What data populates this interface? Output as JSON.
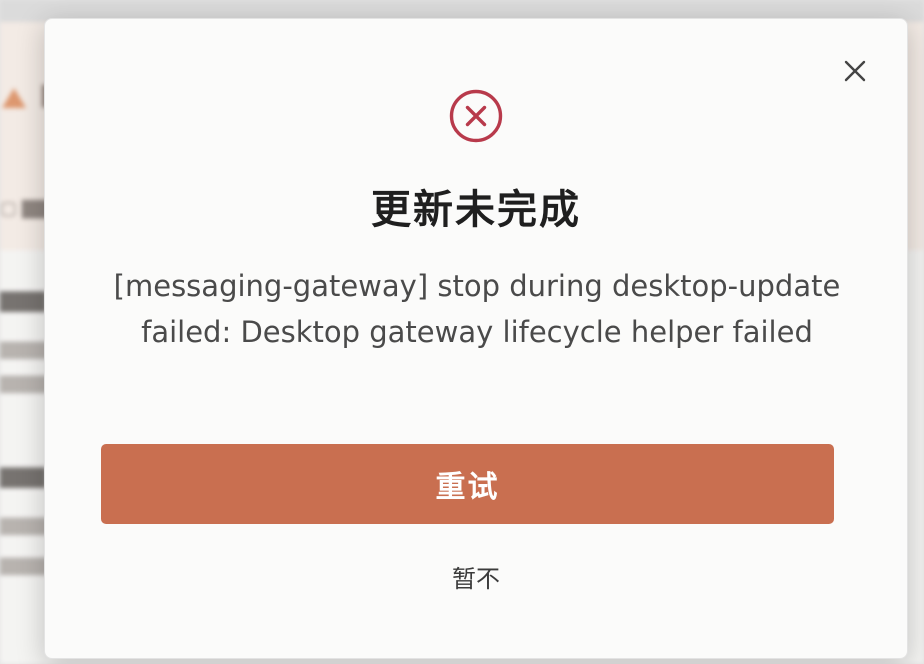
{
  "dialog": {
    "title": "更新未完成",
    "message": "[messaging-gateway] stop during desktop-update failed: Desktop gateway lifecycle helper failed",
    "retry_label": "重试",
    "later_label": "暂不",
    "icons": {
      "close": "close-icon",
      "status": "error-circle-x-icon"
    },
    "colors": {
      "accent": "#c96f50",
      "error": "#b83a4b"
    }
  }
}
